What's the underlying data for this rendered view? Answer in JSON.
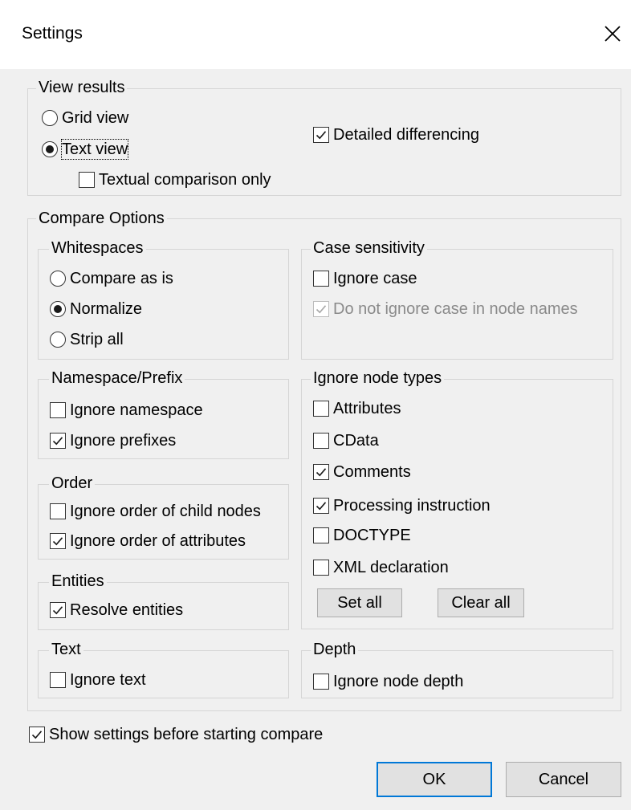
{
  "window": {
    "title": "Settings",
    "close_icon": "close-icon"
  },
  "view_results": {
    "legend": "View results",
    "grid_view": {
      "label": "Grid view",
      "selected": false
    },
    "text_view": {
      "label": "Text view",
      "selected": true
    },
    "textual_comparison_only": {
      "label": "Textual comparison only",
      "checked": false
    },
    "detailed_differencing": {
      "label": "Detailed differencing",
      "checked": true
    }
  },
  "compare_options": {
    "legend": "Compare Options",
    "whitespaces": {
      "legend": "Whitespaces",
      "compare_as_is": {
        "label": "Compare as is",
        "selected": false
      },
      "normalize": {
        "label": "Normalize",
        "selected": true
      },
      "strip_all": {
        "label": "Strip all",
        "selected": false
      }
    },
    "case_sensitivity": {
      "legend": "Case sensitivity",
      "ignore_case": {
        "label": "Ignore case",
        "checked": false
      },
      "do_not_ignore_case_in_node_names": {
        "label": "Do not ignore case in node names",
        "checked": true,
        "enabled": false
      }
    },
    "namespace_prefix": {
      "legend": "Namespace/Prefix",
      "ignore_namespace": {
        "label": "Ignore namespace",
        "checked": false
      },
      "ignore_prefixes": {
        "label": "Ignore prefixes",
        "checked": true
      }
    },
    "ignore_node_types": {
      "legend": "Ignore node types",
      "attributes": {
        "label": "Attributes",
        "checked": false
      },
      "cdata": {
        "label": "CData",
        "checked": false
      },
      "comments": {
        "label": "Comments",
        "checked": true
      },
      "processing_instruction": {
        "label": "Processing instruction",
        "checked": true
      },
      "doctype": {
        "label": "DOCTYPE",
        "checked": false
      },
      "xml_declaration": {
        "label": "XML declaration",
        "checked": false
      },
      "set_all_label": "Set all",
      "clear_all_label": "Clear all"
    },
    "order": {
      "legend": "Order",
      "ignore_order_child_nodes": {
        "label": "Ignore order of child nodes",
        "checked": false
      },
      "ignore_order_attributes": {
        "label": "Ignore order of attributes",
        "checked": true
      }
    },
    "entities": {
      "legend": "Entities",
      "resolve_entities": {
        "label": "Resolve entities",
        "checked": true
      }
    },
    "text": {
      "legend": "Text",
      "ignore_text": {
        "label": "Ignore text",
        "checked": false
      }
    },
    "depth": {
      "legend": "Depth",
      "ignore_node_depth": {
        "label": "Ignore node depth",
        "checked": false
      }
    }
  },
  "show_settings": {
    "label": "Show settings before starting compare",
    "checked": true
  },
  "buttons": {
    "ok_label": "OK",
    "cancel_label": "Cancel"
  },
  "colors": {
    "focus_border": "#0078d7",
    "disabled_text": "#8a8a8a"
  }
}
